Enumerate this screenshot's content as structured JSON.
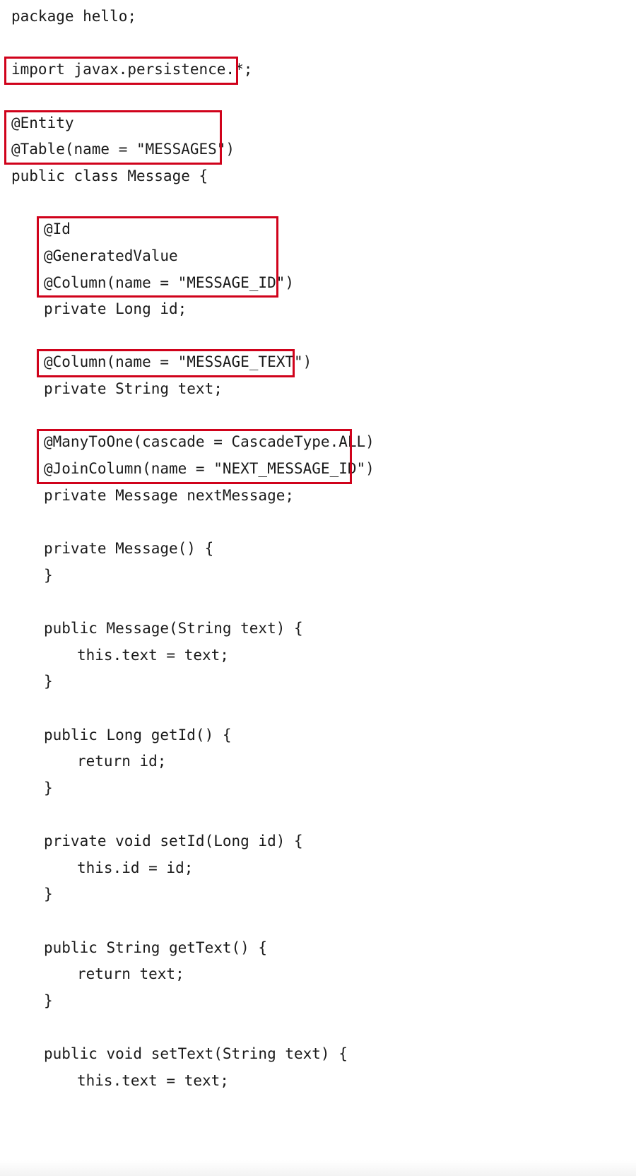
{
  "code": {
    "lines": [
      {
        "indent": 0,
        "text": "package hello;"
      },
      {
        "indent": 0,
        "text": ""
      },
      {
        "indent": 0,
        "text": "import javax.persistence.*;"
      },
      {
        "indent": 0,
        "text": ""
      },
      {
        "indent": 0,
        "text": "@Entity"
      },
      {
        "indent": 0,
        "text": "@Table(name = \"MESSAGES\")"
      },
      {
        "indent": 0,
        "text": "public class Message {"
      },
      {
        "indent": 0,
        "text": ""
      },
      {
        "indent": 1,
        "text": "@Id"
      },
      {
        "indent": 1,
        "text": "@GeneratedValue"
      },
      {
        "indent": 1,
        "text": "@Column(name = \"MESSAGE_ID\")"
      },
      {
        "indent": 1,
        "text": "private Long id;"
      },
      {
        "indent": 0,
        "text": ""
      },
      {
        "indent": 1,
        "text": "@Column(name = \"MESSAGE_TEXT\")"
      },
      {
        "indent": 1,
        "text": "private String text;"
      },
      {
        "indent": 0,
        "text": ""
      },
      {
        "indent": 1,
        "text": "@ManyToOne(cascade = CascadeType.ALL)"
      },
      {
        "indent": 1,
        "text": "@JoinColumn(name = \"NEXT_MESSAGE_ID\")"
      },
      {
        "indent": 1,
        "text": "private Message nextMessage;"
      },
      {
        "indent": 0,
        "text": ""
      },
      {
        "indent": 1,
        "text": "private Message() {"
      },
      {
        "indent": 1,
        "text": "}"
      },
      {
        "indent": 0,
        "text": ""
      },
      {
        "indent": 1,
        "text": "public Message(String text) {"
      },
      {
        "indent": 2,
        "text": "this.text = text;"
      },
      {
        "indent": 1,
        "text": "}"
      },
      {
        "indent": 0,
        "text": ""
      },
      {
        "indent": 1,
        "text": "public Long getId() {"
      },
      {
        "indent": 2,
        "text": "return id;"
      },
      {
        "indent": 1,
        "text": "}"
      },
      {
        "indent": 0,
        "text": ""
      },
      {
        "indent": 1,
        "text": "private void setId(Long id) {"
      },
      {
        "indent": 2,
        "text": "this.id = id;"
      },
      {
        "indent": 1,
        "text": "}"
      },
      {
        "indent": 0,
        "text": ""
      },
      {
        "indent": 1,
        "text": "public String getText() {"
      },
      {
        "indent": 2,
        "text": "return text;"
      },
      {
        "indent": 1,
        "text": "}"
      },
      {
        "indent": 0,
        "text": ""
      },
      {
        "indent": 1,
        "text": "public void setText(String text) {"
      },
      {
        "indent": 2,
        "text": "this.text = text;"
      }
    ],
    "highlights": [
      {
        "name": "highlight-import",
        "first_line": 2,
        "last_line": 2
      },
      {
        "name": "highlight-entity-table",
        "first_line": 4,
        "last_line": 5
      },
      {
        "name": "highlight-id-annotations",
        "first_line": 8,
        "last_line": 10
      },
      {
        "name": "highlight-text-column",
        "first_line": 13,
        "last_line": 13
      },
      {
        "name": "highlight-relationship",
        "first_line": 16,
        "last_line": 17
      }
    ],
    "highlight_color": "#d0021b",
    "text_color": "#1a1a1a",
    "background_color": "#ffffff"
  }
}
